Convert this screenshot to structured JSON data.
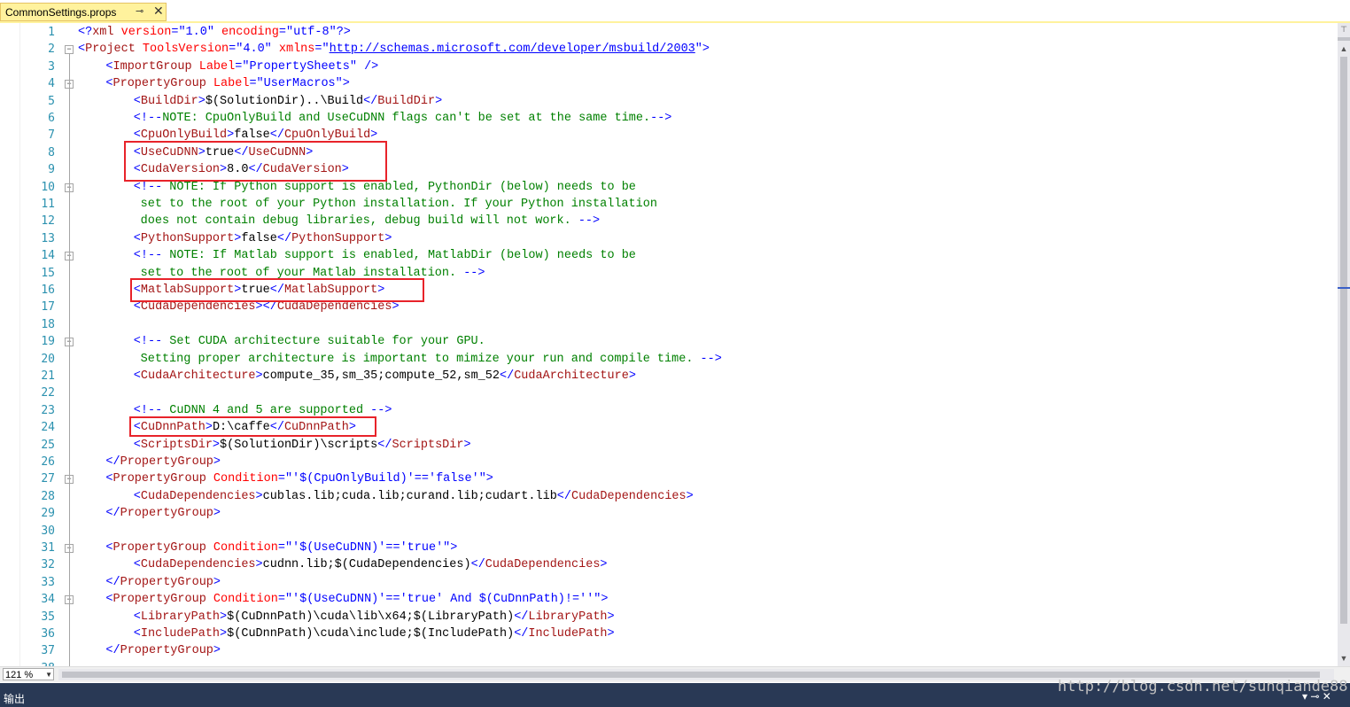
{
  "tab": {
    "title": "CommonSettings.props",
    "pin_icon": "pin-icon",
    "close_icon": "close-icon"
  },
  "colors": {
    "tag": "#a31515",
    "attr": "#ff0000",
    "value": "#0000ff",
    "comment": "#008000",
    "linenum": "#2b91af",
    "highlight": "#e8232a",
    "tab_bg": "#fff29d"
  },
  "lines": [
    {
      "n": "1",
      "indent": 0,
      "fold": "",
      "segs": [
        [
          "t-blue",
          "<?"
        ],
        [
          "t-tag",
          "xml"
        ],
        [
          "t-attr",
          " version"
        ],
        [
          "t-blue",
          "="
        ],
        [
          "t-val",
          "\"1.0\""
        ],
        [
          "t-attr",
          " encoding"
        ],
        [
          "t-blue",
          "="
        ],
        [
          "t-val",
          "\"utf-8\""
        ],
        [
          "t-blue",
          "?>"
        ]
      ]
    },
    {
      "n": "2",
      "indent": 0,
      "fold": "-",
      "segs": [
        [
          "t-blue",
          "<"
        ],
        [
          "t-tag",
          "Project"
        ],
        [
          "t-attr",
          " ToolsVersion"
        ],
        [
          "t-blue",
          "="
        ],
        [
          "t-val",
          "\"4.0\""
        ],
        [
          "t-attr",
          " xmlns"
        ],
        [
          "t-blue",
          "="
        ],
        [
          "t-blue",
          "\""
        ],
        [
          "t-link",
          "http://schemas.microsoft.com/developer/msbuild/2003"
        ],
        [
          "t-blue",
          "\">"
        ]
      ]
    },
    {
      "n": "3",
      "indent": 4,
      "fold": "",
      "segs": [
        [
          "t-blue",
          "<"
        ],
        [
          "t-tag",
          "ImportGroup"
        ],
        [
          "t-attr",
          " Label"
        ],
        [
          "t-blue",
          "="
        ],
        [
          "t-val",
          "\"PropertySheets\""
        ],
        [
          "t-blue",
          " />"
        ]
      ]
    },
    {
      "n": "4",
      "indent": 4,
      "fold": "-",
      "segs": [
        [
          "t-blue",
          "<"
        ],
        [
          "t-tag",
          "PropertyGroup"
        ],
        [
          "t-attr",
          " Label"
        ],
        [
          "t-blue",
          "="
        ],
        [
          "t-val",
          "\"UserMacros\""
        ],
        [
          "t-blue",
          ">"
        ]
      ]
    },
    {
      "n": "5",
      "indent": 8,
      "fold": "",
      "segs": [
        [
          "t-blue",
          "<"
        ],
        [
          "t-tag",
          "BuildDir"
        ],
        [
          "t-blue",
          ">"
        ],
        [
          "t-txt",
          "$(SolutionDir)..\\Build"
        ],
        [
          "t-blue",
          "</"
        ],
        [
          "t-tag",
          "BuildDir"
        ],
        [
          "t-blue",
          ">"
        ]
      ]
    },
    {
      "n": "6",
      "indent": 8,
      "fold": "",
      "segs": [
        [
          "t-blue",
          "<!--"
        ],
        [
          "t-cmt",
          "NOTE: CpuOnlyBuild and UseCuDNN flags can't be set at the same time."
        ],
        [
          "t-blue",
          "-->"
        ]
      ]
    },
    {
      "n": "7",
      "indent": 8,
      "fold": "",
      "segs": [
        [
          "t-blue",
          "<"
        ],
        [
          "t-tag",
          "CpuOnlyBuild"
        ],
        [
          "t-blue",
          ">"
        ],
        [
          "t-txt",
          "false"
        ],
        [
          "t-blue",
          "</"
        ],
        [
          "t-tag",
          "CpuOnlyBuild"
        ],
        [
          "t-blue",
          ">"
        ]
      ]
    },
    {
      "n": "8",
      "indent": 8,
      "fold": "",
      "segs": [
        [
          "t-blue",
          "<"
        ],
        [
          "t-tag",
          "UseCuDNN"
        ],
        [
          "t-blue",
          ">"
        ],
        [
          "t-txt",
          "true"
        ],
        [
          "t-blue",
          "</"
        ],
        [
          "t-tag",
          "UseCuDNN"
        ],
        [
          "t-blue",
          ">"
        ]
      ]
    },
    {
      "n": "9",
      "indent": 8,
      "fold": "",
      "segs": [
        [
          "t-blue",
          "<"
        ],
        [
          "t-tag",
          "CudaVersion"
        ],
        [
          "t-blue",
          ">"
        ],
        [
          "t-txt",
          "8.0"
        ],
        [
          "t-blue",
          "</"
        ],
        [
          "t-tag",
          "CudaVersion"
        ],
        [
          "t-blue",
          ">"
        ]
      ]
    },
    {
      "n": "10",
      "indent": 8,
      "fold": "-",
      "segs": [
        [
          "t-blue",
          "<!--"
        ],
        [
          "t-cmt",
          " NOTE: If Python support is enabled, PythonDir (below) needs to be"
        ]
      ]
    },
    {
      "n": "11",
      "indent": 9,
      "fold": "",
      "segs": [
        [
          "t-cmt",
          "set to the root of your Python installation. If your Python installation"
        ]
      ]
    },
    {
      "n": "12",
      "indent": 9,
      "fold": "",
      "segs": [
        [
          "t-cmt",
          "does not contain debug libraries, debug build will not work. "
        ],
        [
          "t-blue",
          "-->"
        ]
      ]
    },
    {
      "n": "13",
      "indent": 8,
      "fold": "",
      "segs": [
        [
          "t-blue",
          "<"
        ],
        [
          "t-tag",
          "PythonSupport"
        ],
        [
          "t-blue",
          ">"
        ],
        [
          "t-txt",
          "false"
        ],
        [
          "t-blue",
          "</"
        ],
        [
          "t-tag",
          "PythonSupport"
        ],
        [
          "t-blue",
          ">"
        ]
      ]
    },
    {
      "n": "14",
      "indent": 8,
      "fold": "-",
      "segs": [
        [
          "t-blue",
          "<!--"
        ],
        [
          "t-cmt",
          " NOTE: If Matlab support is enabled, MatlabDir (below) needs to be"
        ]
      ]
    },
    {
      "n": "15",
      "indent": 9,
      "fold": "",
      "segs": [
        [
          "t-cmt",
          "set to the root of your Matlab installation. "
        ],
        [
          "t-blue",
          "-->"
        ]
      ]
    },
    {
      "n": "16",
      "indent": 8,
      "fold": "",
      "segs": [
        [
          "t-blue",
          "<"
        ],
        [
          "t-tag",
          "MatlabSupport"
        ],
        [
          "t-blue",
          ">"
        ],
        [
          "t-txt",
          "true"
        ],
        [
          "t-blue",
          "</"
        ],
        [
          "t-tag",
          "MatlabSupport"
        ],
        [
          "t-blue",
          ">"
        ]
      ]
    },
    {
      "n": "17",
      "indent": 8,
      "fold": "",
      "segs": [
        [
          "t-blue",
          "<"
        ],
        [
          "t-tag",
          "CudaDependencies"
        ],
        [
          "t-blue",
          "></"
        ],
        [
          "t-tag",
          "CudaDependencies"
        ],
        [
          "t-blue",
          ">"
        ]
      ]
    },
    {
      "n": "18",
      "indent": 0,
      "fold": "",
      "segs": []
    },
    {
      "n": "19",
      "indent": 8,
      "fold": "-",
      "segs": [
        [
          "t-blue",
          "<!--"
        ],
        [
          "t-cmt",
          " Set CUDA architecture suitable for your GPU."
        ]
      ]
    },
    {
      "n": "20",
      "indent": 9,
      "fold": "",
      "segs": [
        [
          "t-cmt",
          "Setting proper architecture is important to mimize your run and compile time. "
        ],
        [
          "t-blue",
          "-->"
        ]
      ]
    },
    {
      "n": "21",
      "indent": 8,
      "fold": "",
      "segs": [
        [
          "t-blue",
          "<"
        ],
        [
          "t-tag",
          "CudaArchitecture"
        ],
        [
          "t-blue",
          ">"
        ],
        [
          "t-txt",
          "compute_35,sm_35;compute_52,sm_52"
        ],
        [
          "t-blue",
          "</"
        ],
        [
          "t-tag",
          "CudaArchitecture"
        ],
        [
          "t-blue",
          ">"
        ]
      ]
    },
    {
      "n": "22",
      "indent": 0,
      "fold": "",
      "segs": []
    },
    {
      "n": "23",
      "indent": 8,
      "fold": "",
      "segs": [
        [
          "t-blue",
          "<!--"
        ],
        [
          "t-cmt",
          " CuDNN 4 and 5 are supported "
        ],
        [
          "t-blue",
          "-->"
        ]
      ]
    },
    {
      "n": "24",
      "indent": 8,
      "fold": "",
      "segs": [
        [
          "t-blue",
          "<"
        ],
        [
          "t-tag",
          "CuDnnPath"
        ],
        [
          "t-blue",
          ">"
        ],
        [
          "t-txt",
          "D:\\caffe"
        ],
        [
          "t-blue",
          "</"
        ],
        [
          "t-tag",
          "CuDnnPath"
        ],
        [
          "t-blue",
          ">"
        ]
      ]
    },
    {
      "n": "25",
      "indent": 8,
      "fold": "",
      "segs": [
        [
          "t-blue",
          "<"
        ],
        [
          "t-tag",
          "ScriptsDir"
        ],
        [
          "t-blue",
          ">"
        ],
        [
          "t-txt",
          "$(SolutionDir)\\scripts"
        ],
        [
          "t-blue",
          "</"
        ],
        [
          "t-tag",
          "ScriptsDir"
        ],
        [
          "t-blue",
          ">"
        ]
      ]
    },
    {
      "n": "26",
      "indent": 4,
      "fold": "",
      "segs": [
        [
          "t-blue",
          "</"
        ],
        [
          "t-tag",
          "PropertyGroup"
        ],
        [
          "t-blue",
          ">"
        ]
      ]
    },
    {
      "n": "27",
      "indent": 4,
      "fold": "-",
      "segs": [
        [
          "t-blue",
          "<"
        ],
        [
          "t-tag",
          "PropertyGroup"
        ],
        [
          "t-attr",
          " Condition"
        ],
        [
          "t-blue",
          "="
        ],
        [
          "t-val",
          "\"'$(CpuOnlyBuild)'=='false'\""
        ],
        [
          "t-blue",
          ">"
        ]
      ]
    },
    {
      "n": "28",
      "indent": 8,
      "fold": "",
      "segs": [
        [
          "t-blue",
          "<"
        ],
        [
          "t-tag",
          "CudaDependencies"
        ],
        [
          "t-blue",
          ">"
        ],
        [
          "t-txt",
          "cublas.lib;cuda.lib;curand.lib;cudart.lib"
        ],
        [
          "t-blue",
          "</"
        ],
        [
          "t-tag",
          "CudaDependencies"
        ],
        [
          "t-blue",
          ">"
        ]
      ]
    },
    {
      "n": "29",
      "indent": 4,
      "fold": "",
      "segs": [
        [
          "t-blue",
          "</"
        ],
        [
          "t-tag",
          "PropertyGroup"
        ],
        [
          "t-blue",
          ">"
        ]
      ]
    },
    {
      "n": "30",
      "indent": 0,
      "fold": "",
      "segs": []
    },
    {
      "n": "31",
      "indent": 4,
      "fold": "-",
      "segs": [
        [
          "t-blue",
          "<"
        ],
        [
          "t-tag",
          "PropertyGroup"
        ],
        [
          "t-attr",
          " Condition"
        ],
        [
          "t-blue",
          "="
        ],
        [
          "t-val",
          "\"'$(UseCuDNN)'=='true'\""
        ],
        [
          "t-blue",
          ">"
        ]
      ]
    },
    {
      "n": "32",
      "indent": 8,
      "fold": "",
      "segs": [
        [
          "t-blue",
          "<"
        ],
        [
          "t-tag",
          "CudaDependencies"
        ],
        [
          "t-blue",
          ">"
        ],
        [
          "t-txt",
          "cudnn.lib;$(CudaDependencies)"
        ],
        [
          "t-blue",
          "</"
        ],
        [
          "t-tag",
          "CudaDependencies"
        ],
        [
          "t-blue",
          ">"
        ]
      ]
    },
    {
      "n": "33",
      "indent": 4,
      "fold": "",
      "segs": [
        [
          "t-blue",
          "</"
        ],
        [
          "t-tag",
          "PropertyGroup"
        ],
        [
          "t-blue",
          ">"
        ]
      ]
    },
    {
      "n": "34",
      "indent": 4,
      "fold": "-",
      "segs": [
        [
          "t-blue",
          "<"
        ],
        [
          "t-tag",
          "PropertyGroup"
        ],
        [
          "t-attr",
          " Condition"
        ],
        [
          "t-blue",
          "="
        ],
        [
          "t-val",
          "\"'$(UseCuDNN)'=='true' And $(CuDnnPath)!=''\""
        ],
        [
          "t-blue",
          ">"
        ]
      ]
    },
    {
      "n": "35",
      "indent": 8,
      "fold": "",
      "segs": [
        [
          "t-blue",
          "<"
        ],
        [
          "t-tag",
          "LibraryPath"
        ],
        [
          "t-blue",
          ">"
        ],
        [
          "t-txt",
          "$(CuDnnPath)\\cuda\\lib\\x64;$(LibraryPath)"
        ],
        [
          "t-blue",
          "</"
        ],
        [
          "t-tag",
          "LibraryPath"
        ],
        [
          "t-blue",
          ">"
        ]
      ]
    },
    {
      "n": "36",
      "indent": 8,
      "fold": "",
      "segs": [
        [
          "t-blue",
          "<"
        ],
        [
          "t-tag",
          "IncludePath"
        ],
        [
          "t-blue",
          ">"
        ],
        [
          "t-txt",
          "$(CuDnnPath)\\cuda\\include;$(IncludePath)"
        ],
        [
          "t-blue",
          "</"
        ],
        [
          "t-tag",
          "IncludePath"
        ],
        [
          "t-blue",
          ">"
        ]
      ]
    },
    {
      "n": "37",
      "indent": 4,
      "fold": "",
      "segs": [
        [
          "t-blue",
          "</"
        ],
        [
          "t-tag",
          "PropertyGroup"
        ],
        [
          "t-blue",
          ">"
        ]
      ]
    },
    {
      "n": "38",
      "indent": 0,
      "fold": "",
      "segs": []
    }
  ],
  "zoom": {
    "value": "121 %"
  },
  "output_panel": {
    "label": "输出"
  },
  "watermark": "http://blog.csdn.net/sunqiande88"
}
